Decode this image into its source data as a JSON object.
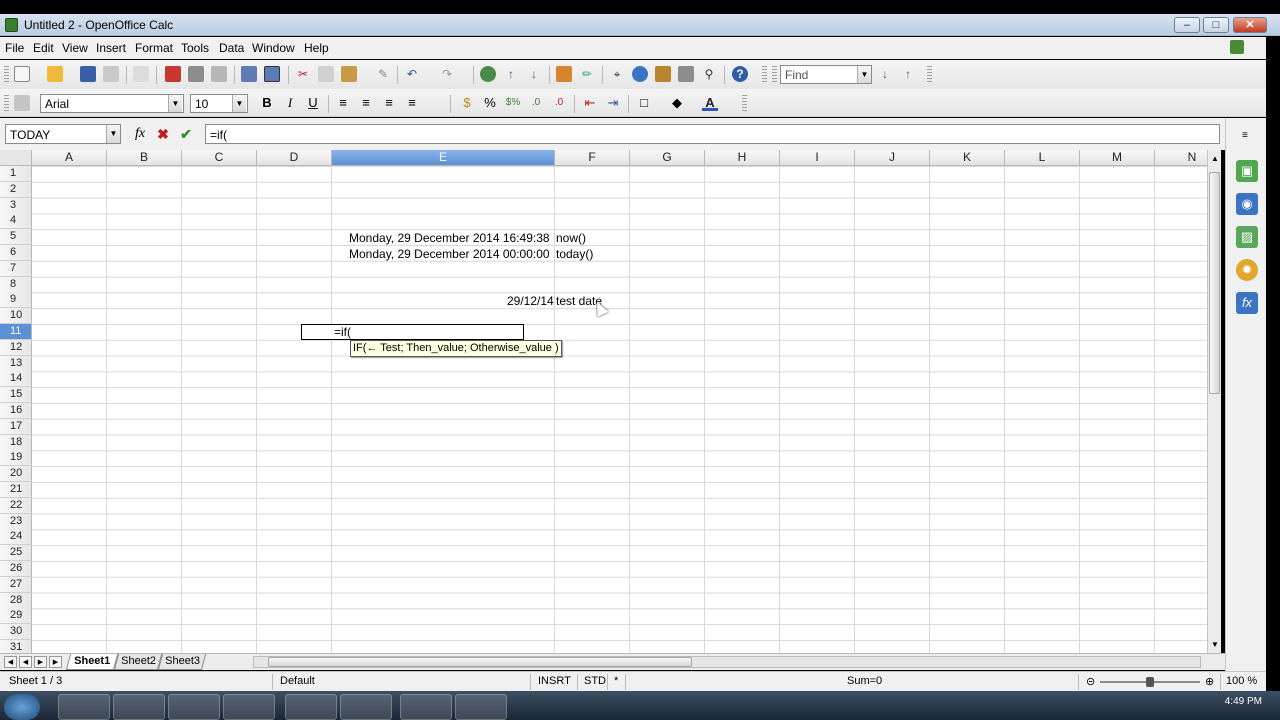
{
  "window": {
    "title": "Untitled 2 - OpenOffice Calc"
  },
  "menu": [
    "File",
    "Edit",
    "View",
    "Insert",
    "Format",
    "Tools",
    "Data",
    "Window",
    "Help"
  ],
  "toolbar": {
    "find_value": "Find"
  },
  "format": {
    "font_name": "Arial",
    "font_size": "10",
    "bold": "B",
    "italic": "I",
    "underline": "U"
  },
  "formula_bar": {
    "name_box": "TODAY",
    "content": "=if("
  },
  "columns": [
    "A",
    "B",
    "C",
    "D",
    "E",
    "F",
    "G",
    "H",
    "I",
    "J",
    "K",
    "L",
    "M",
    "N"
  ],
  "selected_column": "E",
  "rows": [
    "1",
    "2",
    "3",
    "4",
    "5",
    "6",
    "7",
    "8",
    "9",
    "10",
    "11",
    "12",
    "13",
    "14",
    "15",
    "16",
    "17",
    "18",
    "19",
    "20",
    "21",
    "22",
    "23",
    "24",
    "25",
    "26",
    "27",
    "28",
    "29",
    "30",
    "31"
  ],
  "selected_row": "11",
  "cells": {
    "e5": "Monday, 29 December 2014  16:49:38",
    "f5": "now()",
    "e6": "Monday, 29 December 2014  00:00:00",
    "f6": "today()",
    "e9": "29/12/14",
    "f9": "test date",
    "e11": "=if("
  },
  "tooltip": "IF(← Test; Then_value; Otherwise_value )",
  "sheets": [
    "Sheet1",
    "Sheet2",
    "Sheet3"
  ],
  "active_sheet": "Sheet1",
  "status": {
    "sheet": "Sheet 1 / 3",
    "style": "Default",
    "mode": "INSRT",
    "selection": "STD",
    "modified": "*",
    "sum": "Sum=0",
    "zoom": "100 %"
  },
  "taskbar": {
    "clock": "4:49 PM"
  },
  "colors": {
    "selected_header": "#5b8fd6",
    "tooltip_bg": "#ffffe1"
  }
}
